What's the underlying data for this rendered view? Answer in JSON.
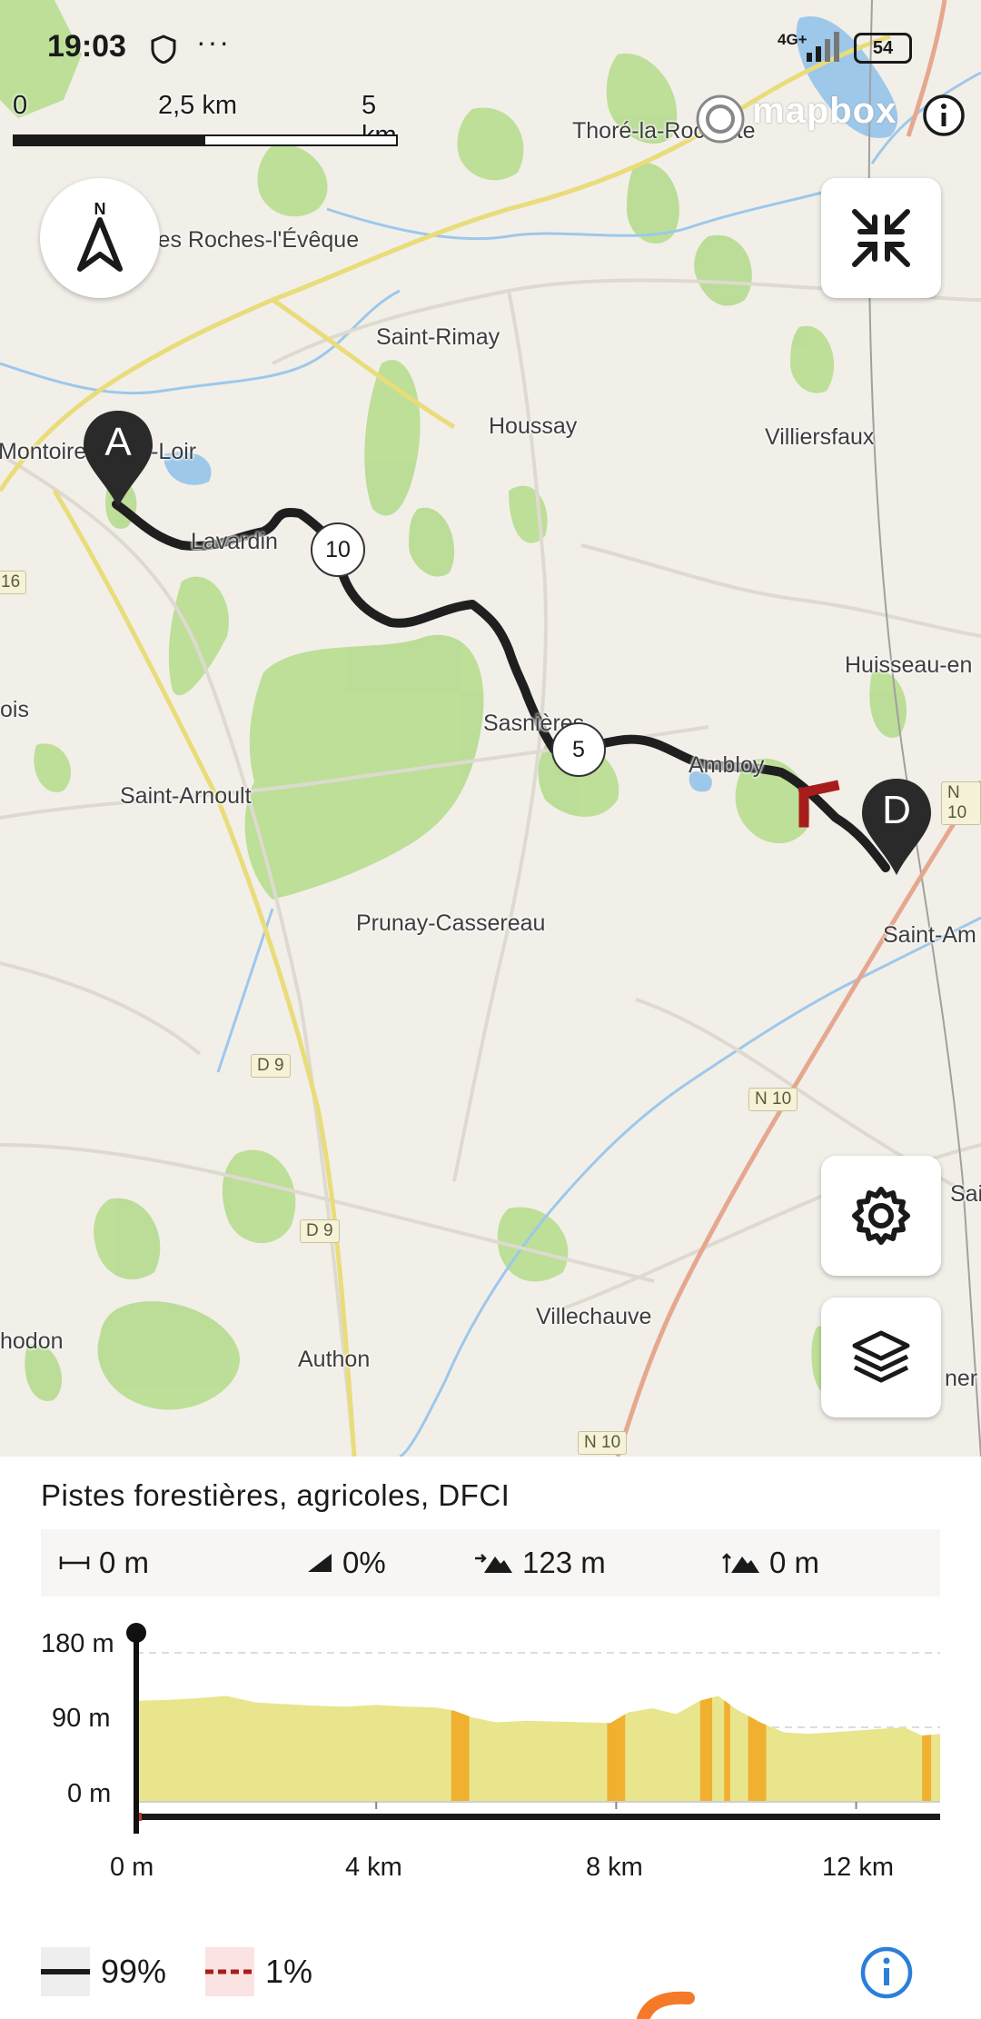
{
  "status_bar": {
    "time": "19:03",
    "network": "4G+",
    "battery": "54"
  },
  "scale_bar": {
    "labels": [
      "0",
      "2,5 km",
      "5 km"
    ]
  },
  "attribution": {
    "brand": "mapbox"
  },
  "map_labels": [
    {
      "text": "Thoré-la-Rochette"
    },
    {
      "text": "les Roches-l'Évêque"
    },
    {
      "text": "Saint-Rimay"
    },
    {
      "text": "Houssay"
    },
    {
      "text": "Villiersfaux"
    },
    {
      "text": "Montoire-sur-le-Loir"
    },
    {
      "text": "Lavardin"
    },
    {
      "text": "Huisseau-en"
    },
    {
      "text": "ois"
    },
    {
      "text": "Sasnières"
    },
    {
      "text": "Ambloy"
    },
    {
      "text": "Saint-Arnoult"
    },
    {
      "text": "Prunay-Cassereau"
    },
    {
      "text": "Saint-Am"
    },
    {
      "text": "Sai"
    },
    {
      "text": "Villechauve"
    },
    {
      "text": "hodon"
    },
    {
      "text": "Authon"
    },
    {
      "text": "ner"
    }
  ],
  "road_signs": [
    "N 10",
    "D 9",
    "N 10",
    "D 9",
    "N 10",
    "16"
  ],
  "markers": {
    "start": "A",
    "end": "D",
    "waypoint_10": "10",
    "waypoint_5": "5"
  },
  "icons": {
    "compass": "north-arrow-icon",
    "collapse": "collapse-arrows-icon",
    "settings": "gear-icon",
    "layers": "layers-icon",
    "info": "info-icon"
  },
  "panel": {
    "title": "Pistes forestières, agricoles, DFCI",
    "stats": {
      "distance": "0 m",
      "grade": "0%",
      "max_elevation": "123 m",
      "ascent": "0 m"
    },
    "legend": {
      "solid_percent": "99%",
      "dashed_percent": "1%"
    }
  },
  "chart_data": {
    "type": "area",
    "title": "",
    "xlabel": "",
    "ylabel": "",
    "y_tick_labels": [
      "180 m",
      "90 m",
      "0 m"
    ],
    "x_tick_labels": [
      "0 m",
      "4 km",
      "8 km",
      "12 km"
    ],
    "ylim": [
      0,
      180
    ],
    "xlim_km": [
      0,
      13.4
    ],
    "x_km": [
      0,
      0.5,
      1,
      1.5,
      2,
      2.5,
      3,
      3.5,
      4,
      4.5,
      5,
      5.3,
      5.6,
      6,
      6.5,
      7,
      7.5,
      7.9,
      8.2,
      8.6,
      9,
      9.4,
      9.7,
      10,
      10.4,
      10.8,
      11.2,
      11.6,
      12,
      12.4,
      12.8,
      13.1,
      13.4
    ],
    "elevation_m": [
      122,
      123,
      125,
      128,
      120,
      118,
      116,
      115,
      117,
      115,
      114,
      110,
      102,
      96,
      98,
      97,
      96,
      95,
      108,
      113,
      106,
      122,
      128,
      112,
      96,
      84,
      82,
      84,
      86,
      88,
      90,
      80,
      82
    ],
    "steep_sections_km": [
      [
        5.25,
        5.55
      ],
      [
        7.85,
        8.15
      ],
      [
        9.4,
        9.6
      ],
      [
        9.8,
        9.9
      ],
      [
        10.2,
        10.5
      ],
      [
        13.1,
        13.25
      ]
    ],
    "cursor_km": 0,
    "colors": {
      "fill": "#e8e58c",
      "steep": "#f0b030",
      "cursor": "#111111"
    }
  }
}
